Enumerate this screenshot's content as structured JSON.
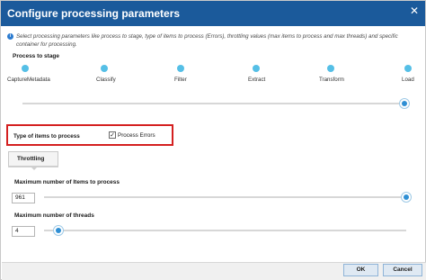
{
  "dialog": {
    "title": "Configure processing parameters",
    "info": "Select processing parameters like process to stage, type of items to process (Errors), throttling values (max items to process and max threads) and specific container for processing."
  },
  "process_to_stage": {
    "label": "Process to stage",
    "stages": [
      "CaptureMetadata",
      "Classify",
      "Filter",
      "Extract",
      "Transform",
      "Load"
    ],
    "selected": "Load"
  },
  "type_of_items": {
    "label": "Type of items to process",
    "checkbox_label": "Process Errors",
    "checked": true
  },
  "tabs": [
    "Throttling"
  ],
  "throttling": {
    "max_items_label": "Maximum number of Items to process",
    "max_items_value": "961",
    "max_items_fraction": 1.0,
    "max_threads_label": "Maximum number of threads",
    "max_threads_value": "4",
    "max_threads_fraction": 0.04
  },
  "buttons": {
    "ok": "OK",
    "cancel": "Cancel"
  },
  "colors": {
    "title_bar": "#1b5a9b",
    "highlight": "#d42020",
    "accent": "#2f8fd4"
  }
}
